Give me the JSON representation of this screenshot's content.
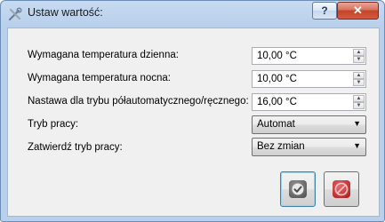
{
  "window": {
    "title": "Ustaw wartość:",
    "help_glyph": "?",
    "close_glyph": "✕"
  },
  "fields": [
    {
      "label": "Wymagana temperatura dzienna:",
      "value": "10,00 °C",
      "control": "spinbox"
    },
    {
      "label": "Wymagana temperatura nocna:",
      "value": "10,00 °C",
      "control": "spinbox"
    },
    {
      "label": "Nastawa dla trybu półautomatycznego/ręcznego:",
      "value": "16,00 °C",
      "control": "spinbox"
    },
    {
      "label": "Tryb pracy:",
      "value": "Automat",
      "control": "combobox"
    },
    {
      "label": "Zatwierdź tryb pracy:",
      "value": "Bez zmian",
      "control": "combobox"
    }
  ],
  "icons": {
    "app": "tools-icon",
    "ok": "checkmark-icon",
    "cancel": "no-entry-icon",
    "spin_up": "▲",
    "spin_down": "▼",
    "combo_arrow": "▼"
  },
  "colors": {
    "frame": "#b9d0ec",
    "close_button": "#c4442a",
    "ok_accent": "#3c7fb1",
    "cancel_icon": "#a81616"
  }
}
